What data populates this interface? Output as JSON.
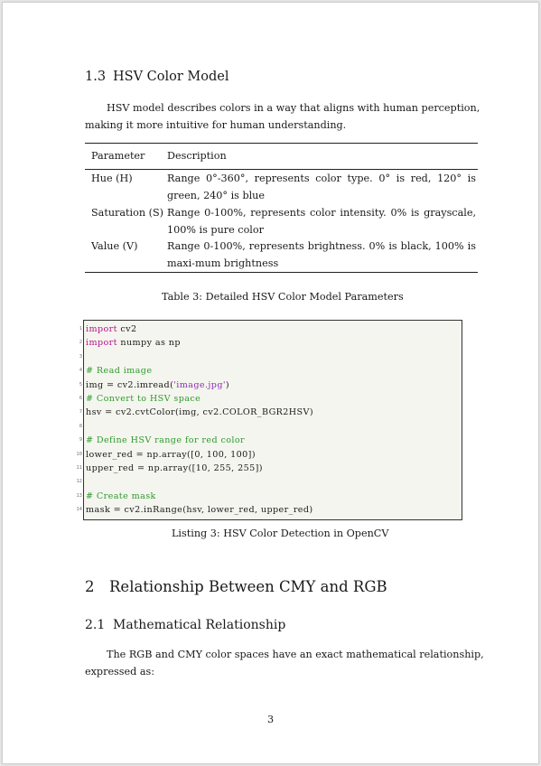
{
  "section_1_3": {
    "number": "1.3",
    "title": "HSV Color Model",
    "paragraph_line1": "HSV model describes colors in a way that aligns with human perception,",
    "paragraph_line2": "making it more intuitive for human understanding."
  },
  "table": {
    "headers": [
      "Parameter",
      "Description"
    ],
    "rows": [
      {
        "param": "Hue (H)",
        "desc": "Range 0°-360°, represents color type. 0° is red, 120° is green, 240° is blue"
      },
      {
        "param": "Saturation (S)",
        "desc": "Range 0-100%, represents color intensity. 0% is grayscale, 100% is pure color"
      },
      {
        "param": "Value (V)",
        "desc": "Range 0-100%, represents brightness. 0% is black, 100% is maxi-mum brightness"
      }
    ],
    "caption": "Table 3: Detailed HSV Color Model Parameters"
  },
  "listing": {
    "line_numbers": [
      "1",
      "2",
      "3",
      "4",
      "5",
      "6",
      "7",
      "8",
      "9",
      "10",
      "11",
      "12",
      "13",
      "14"
    ],
    "lines": [
      {
        "parts": [
          {
            "t": "import",
            "c": "kw"
          },
          {
            "t": " cv2",
            "c": ""
          }
        ]
      },
      {
        "parts": [
          {
            "t": "import",
            "c": "kw"
          },
          {
            "t": " numpy as np",
            "c": ""
          }
        ]
      },
      {
        "parts": []
      },
      {
        "parts": [
          {
            "t": "# Read image",
            "c": "cm"
          }
        ]
      },
      {
        "parts": [
          {
            "t": "img = cv2.imread(",
            "c": ""
          },
          {
            "t": "'image.jpg'",
            "c": "st"
          },
          {
            "t": ")",
            "c": ""
          }
        ]
      },
      {
        "parts": [
          {
            "t": "# Convert to HSV space",
            "c": "cm"
          }
        ]
      },
      {
        "parts": [
          {
            "t": "hsv = cv2.cvtColor(img, cv2.COLOR_BGR2HSV)",
            "c": ""
          }
        ]
      },
      {
        "parts": []
      },
      {
        "parts": [
          {
            "t": "# Define HSV range for red color",
            "c": "cm"
          }
        ]
      },
      {
        "parts": [
          {
            "t": "lower_red = np.array([0, 100, 100])",
            "c": ""
          }
        ]
      },
      {
        "parts": [
          {
            "t": "upper_red = np.array([10, 255, 255])",
            "c": ""
          }
        ]
      },
      {
        "parts": []
      },
      {
        "parts": [
          {
            "t": "# Create mask",
            "c": "cm"
          }
        ]
      },
      {
        "parts": [
          {
            "t": "mask = cv2.inRange(hsv, lower_red, upper_red)",
            "c": ""
          }
        ]
      }
    ],
    "caption": "Listing 3: HSV Color Detection in OpenCV",
    "colors": {
      "keyword": "#b5148a",
      "comment": "#2e9a2e",
      "string": "#8a2fb5",
      "background": "#f5f5ef"
    }
  },
  "section_2": {
    "number": "2",
    "title": "Relationship Between CMY and RGB"
  },
  "section_2_1": {
    "number": "2.1",
    "title": "Mathematical Relationship",
    "paragraph_line1": "The RGB and CMY color spaces have an exact mathematical relationship,",
    "paragraph_line2": "expressed as:"
  },
  "page_number": "3"
}
